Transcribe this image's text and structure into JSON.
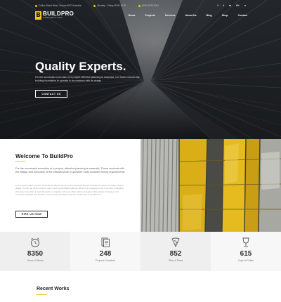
{
  "topbar": {
    "address": "Collins Street West, Victoria 8007 Australia",
    "hours": "Monday - Friday 08:00-18:00",
    "phone": "(555) 8785-9001",
    "social": [
      "f",
      "t",
      "in",
      "G+",
      "v"
    ]
  },
  "brand": {
    "name": "BUILDPRO",
    "tagline": "CONSTRUCTION",
    "mark": "B"
  },
  "menu": [
    "Home",
    "Projects",
    "Services",
    "About Us",
    "Blog",
    "Shop",
    "Contact"
  ],
  "hero": {
    "title": "Quality Experts.",
    "text": "For the successful execution of a project effective planning is essential. Our team ensures the building foundation to operate in accordance with its design.",
    "button": "CONTACT US"
  },
  "welcome": {
    "title": "Welcome To BuildPro",
    "text": "For the successful execution of a project, effective planning is essential. Those involved with the design and execution of the infrastructure in question must consider zoning requirements.",
    "subtext": "Lorem ipsum dolor sit amet, consectetur adipiscing elit, sed do eiusmod tempor incididunt ut labore et dolore magna aliqua. Ut enim ad minim veniam, quis nostrud exercitation ullamco laboris nisi ut aliquip ex ea commodo consequat. Duis aute irure dolor in reprehenderit in voluptate velit esse cillum dolore eu fugiat nulla pariatur. Excepteur sint occaecat cupidatat non proident, sunt in culpa qui officia deserunt mollit anim id est laborum.",
    "button": "HIRE US NOW"
  },
  "stats": [
    {
      "icon": "alarm-clock-icon",
      "number": "8350",
      "label": "Hours of Works"
    },
    {
      "icon": "documents-icon",
      "number": "248",
      "label": "Projects Complete"
    },
    {
      "icon": "pizza-slice-icon",
      "number": "852",
      "label": "Slice of Pizza"
    },
    {
      "icon": "coffee-cup-icon",
      "number": "615",
      "label": "Cups of Coffee"
    }
  ],
  "recent": {
    "title": "Recent Works"
  },
  "colors": {
    "accent": "#f2c811",
    "hero_bg": "#2a2f36",
    "text_dark": "#222222"
  }
}
